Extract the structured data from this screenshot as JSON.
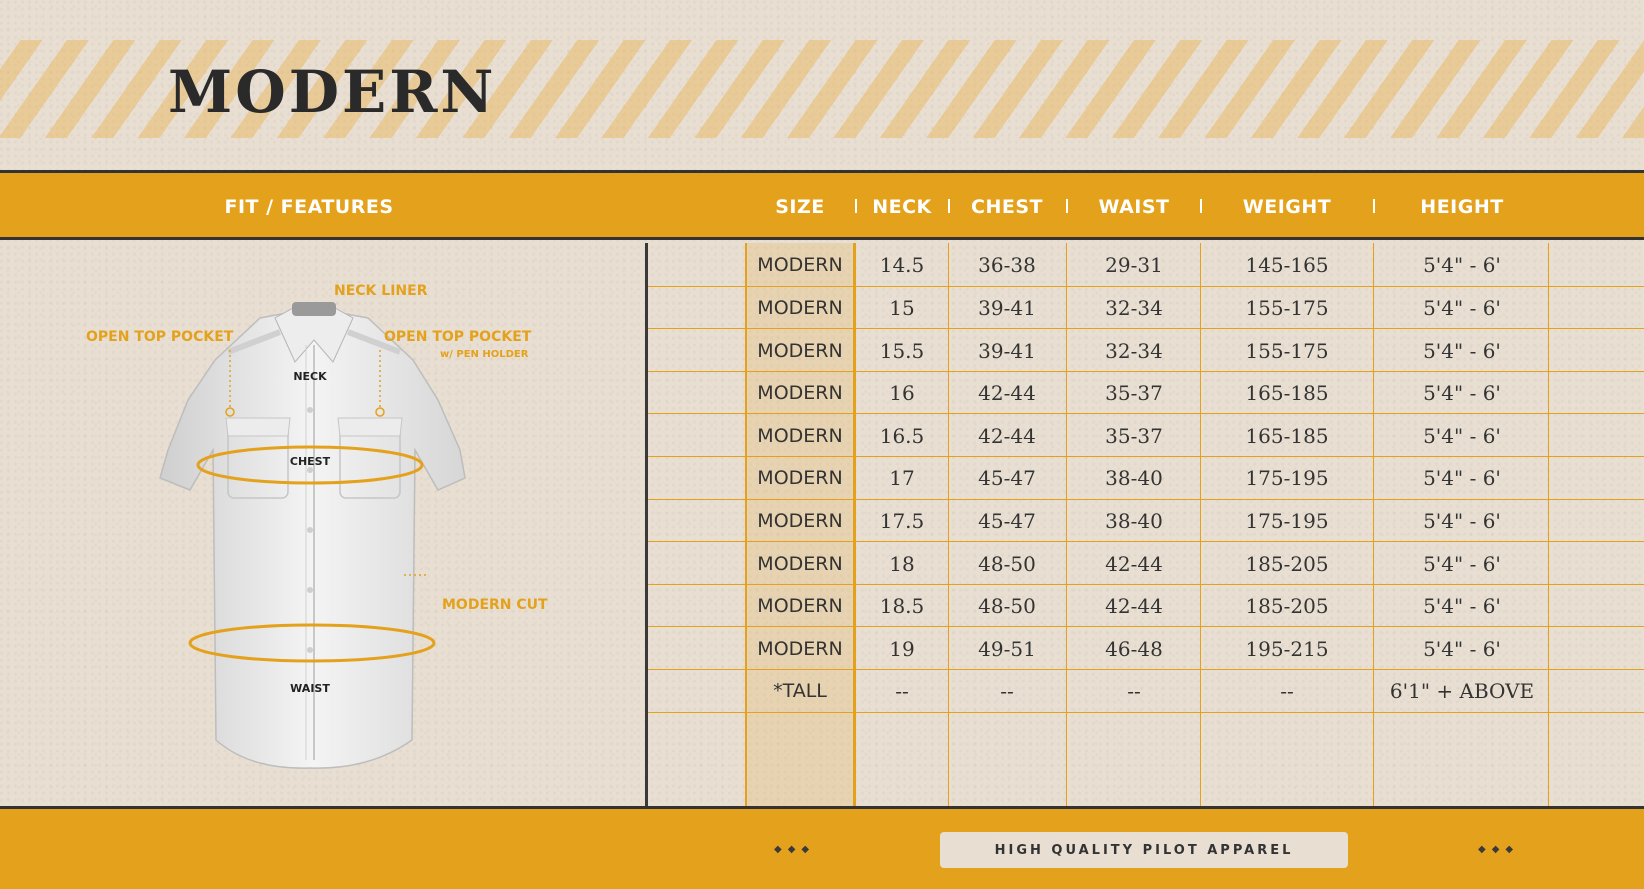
{
  "title": "MODERN",
  "header": {
    "features": "FIT / FEATURES",
    "columns": [
      "SIZE",
      "NECK",
      "CHEST",
      "WAIST",
      "WEIGHT",
      "HEIGHT"
    ]
  },
  "features": {
    "neck_liner": "NECK LINER",
    "open_top_pocket_left": "OPEN TOP POCKET",
    "open_top_pocket_right": "OPEN TOP POCKET",
    "pen_holder": "w/ PEN HOLDER",
    "neck": "NECK",
    "chest": "CHEST",
    "modern_cut": "MODERN CUT",
    "waist": "WAIST"
  },
  "rows": [
    [
      "MODERN",
      "14.5",
      "36-38",
      "29-31",
      "145-165",
      "5'4\" - 6'"
    ],
    [
      "MODERN",
      "15",
      "39-41",
      "32-34",
      "155-175",
      "5'4\" - 6'"
    ],
    [
      "MODERN",
      "15.5",
      "39-41",
      "32-34",
      "155-175",
      "5'4\" - 6'"
    ],
    [
      "MODERN",
      "16",
      "42-44",
      "35-37",
      "165-185",
      "5'4\" - 6'"
    ],
    [
      "MODERN",
      "16.5",
      "42-44",
      "35-37",
      "165-185",
      "5'4\" - 6'"
    ],
    [
      "MODERN",
      "17",
      "45-47",
      "38-40",
      "175-195",
      "5'4\" - 6'"
    ],
    [
      "MODERN",
      "17.5",
      "45-47",
      "38-40",
      "175-195",
      "5'4\" - 6'"
    ],
    [
      "MODERN",
      "18",
      "48-50",
      "42-44",
      "185-205",
      "5'4\" - 6'"
    ],
    [
      "MODERN",
      "18.5",
      "48-50",
      "42-44",
      "185-205",
      "5'4\" - 6'"
    ],
    [
      "MODERN",
      "19",
      "49-51",
      "46-48",
      "195-215",
      "5'4\" - 6'"
    ],
    [
      "*TALL",
      "--",
      "--",
      "--",
      "--",
      "6'1\" + ABOVE"
    ]
  ],
  "footer": {
    "tagline": "HIGH QUALITY PILOT APPAREL",
    "dots_left": "◆◆◆",
    "dots_right": "◆◆◆"
  },
  "colors": {
    "accent": "#e4a11c",
    "paper": "#e8dfd2",
    "ink": "#2b2b2b"
  }
}
